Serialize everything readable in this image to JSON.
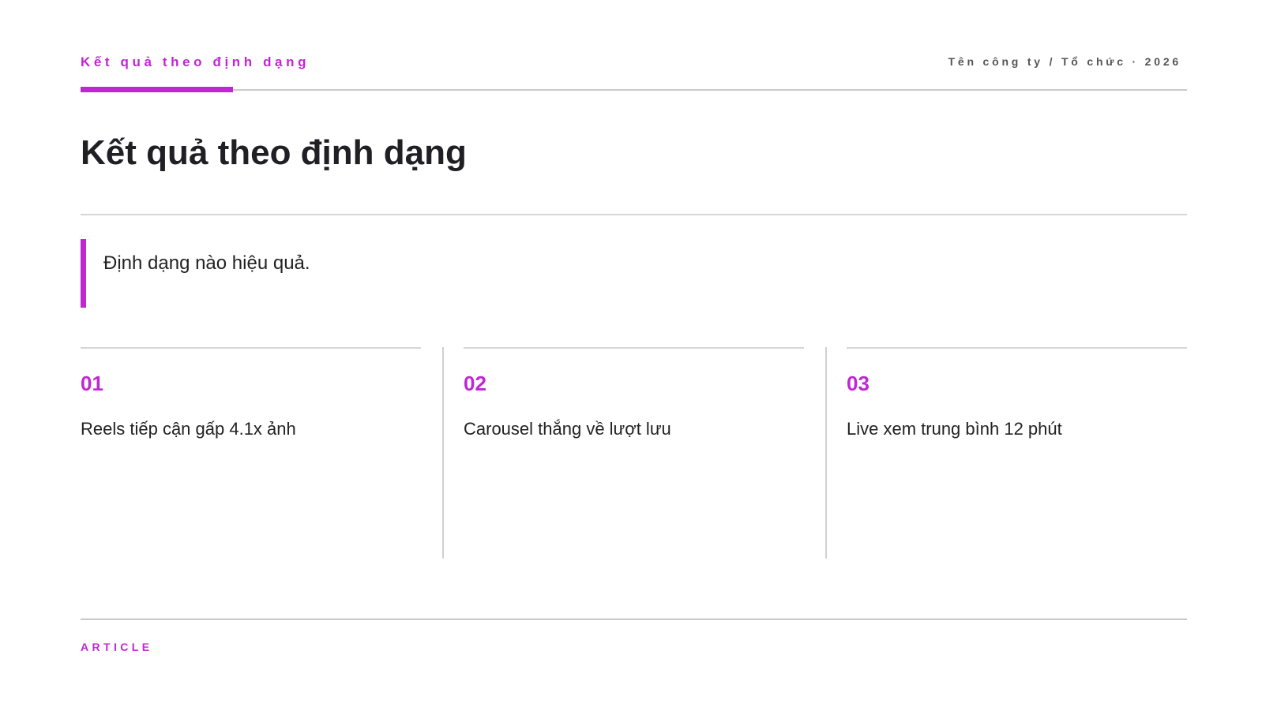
{
  "header": {
    "kicker": "Kết quả theo định dạng",
    "organization": "Tên công ty / Tổ chức · 2026"
  },
  "title": "Kết quả theo định dạng",
  "quote": "Định dạng nào hiệu quả.",
  "cards": [
    {
      "number": "01",
      "text": "Reels tiếp cận gấp 4.1x ảnh"
    },
    {
      "number": "02",
      "text": "Carousel thắng về lượt lưu"
    },
    {
      "number": "03",
      "text": "Live xem trung bình 12 phút"
    }
  ],
  "footer": {
    "label": "ARTICLE"
  },
  "colors": {
    "accent": "#c026d3",
    "text": "#1f1f24",
    "rule": "#c9c9c9"
  }
}
